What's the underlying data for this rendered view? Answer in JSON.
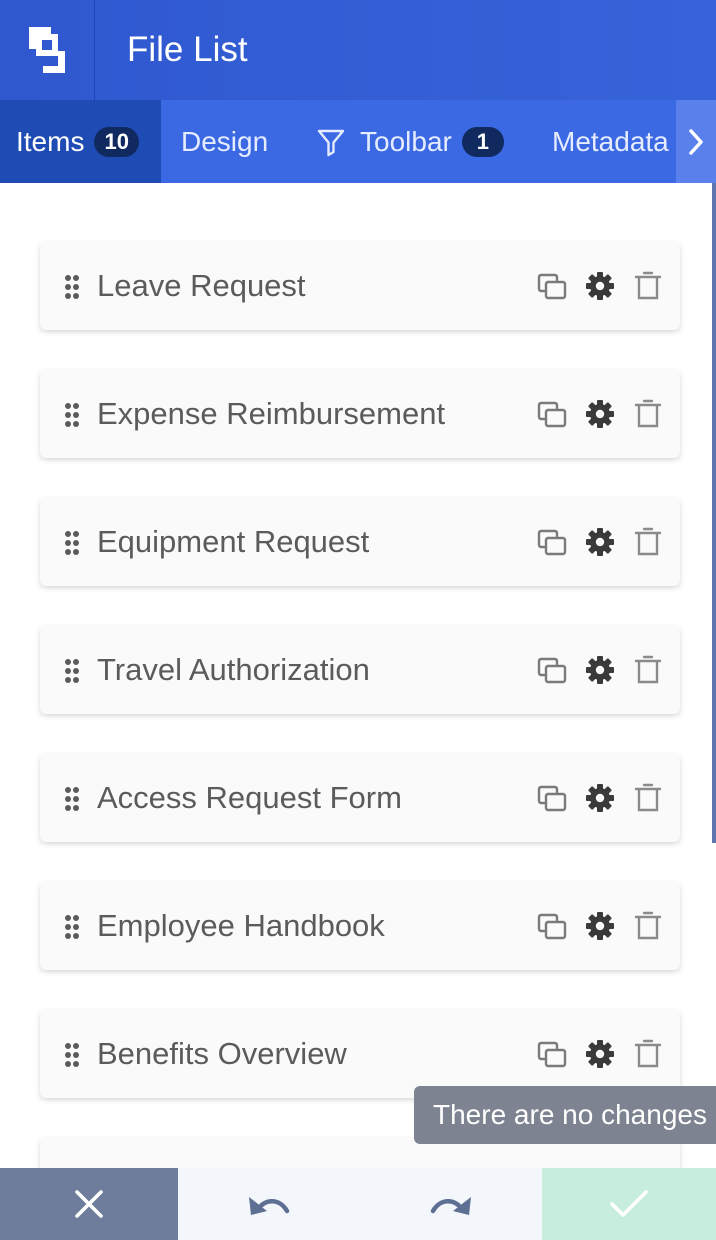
{
  "header": {
    "title": "File List",
    "logo_icon": "brand-logo-icon"
  },
  "tabs": [
    {
      "label": "Items",
      "badge": "10",
      "active": true
    },
    {
      "label": "Design",
      "active": false
    },
    {
      "label": "Toolbar",
      "badge": "1",
      "icon": "filter-icon",
      "active": false
    },
    {
      "label": "Metadata",
      "active": false
    }
  ],
  "items": [
    {
      "label": "Leave Request"
    },
    {
      "label": "Expense Reimbursement"
    },
    {
      "label": "Equipment Request"
    },
    {
      "label": "Travel Authorization"
    },
    {
      "label": "Access Request Form"
    },
    {
      "label": "Employee Handbook"
    },
    {
      "label": "Benefits Overview"
    }
  ],
  "tooltip": {
    "text": "There are no changes"
  },
  "footer": {
    "cancel_icon": "close-icon",
    "undo_icon": "undo-icon",
    "redo_icon": "redo-icon",
    "save_icon": "check-icon"
  },
  "colors": {
    "header": "#2f58cf",
    "tab_bar": "#3b69e3",
    "active_tab": "#1e4bb4",
    "badge": "#10295f",
    "item_text": "#5b5b5b",
    "cancel": "#6e7d9b",
    "save": "#c7eedd"
  }
}
